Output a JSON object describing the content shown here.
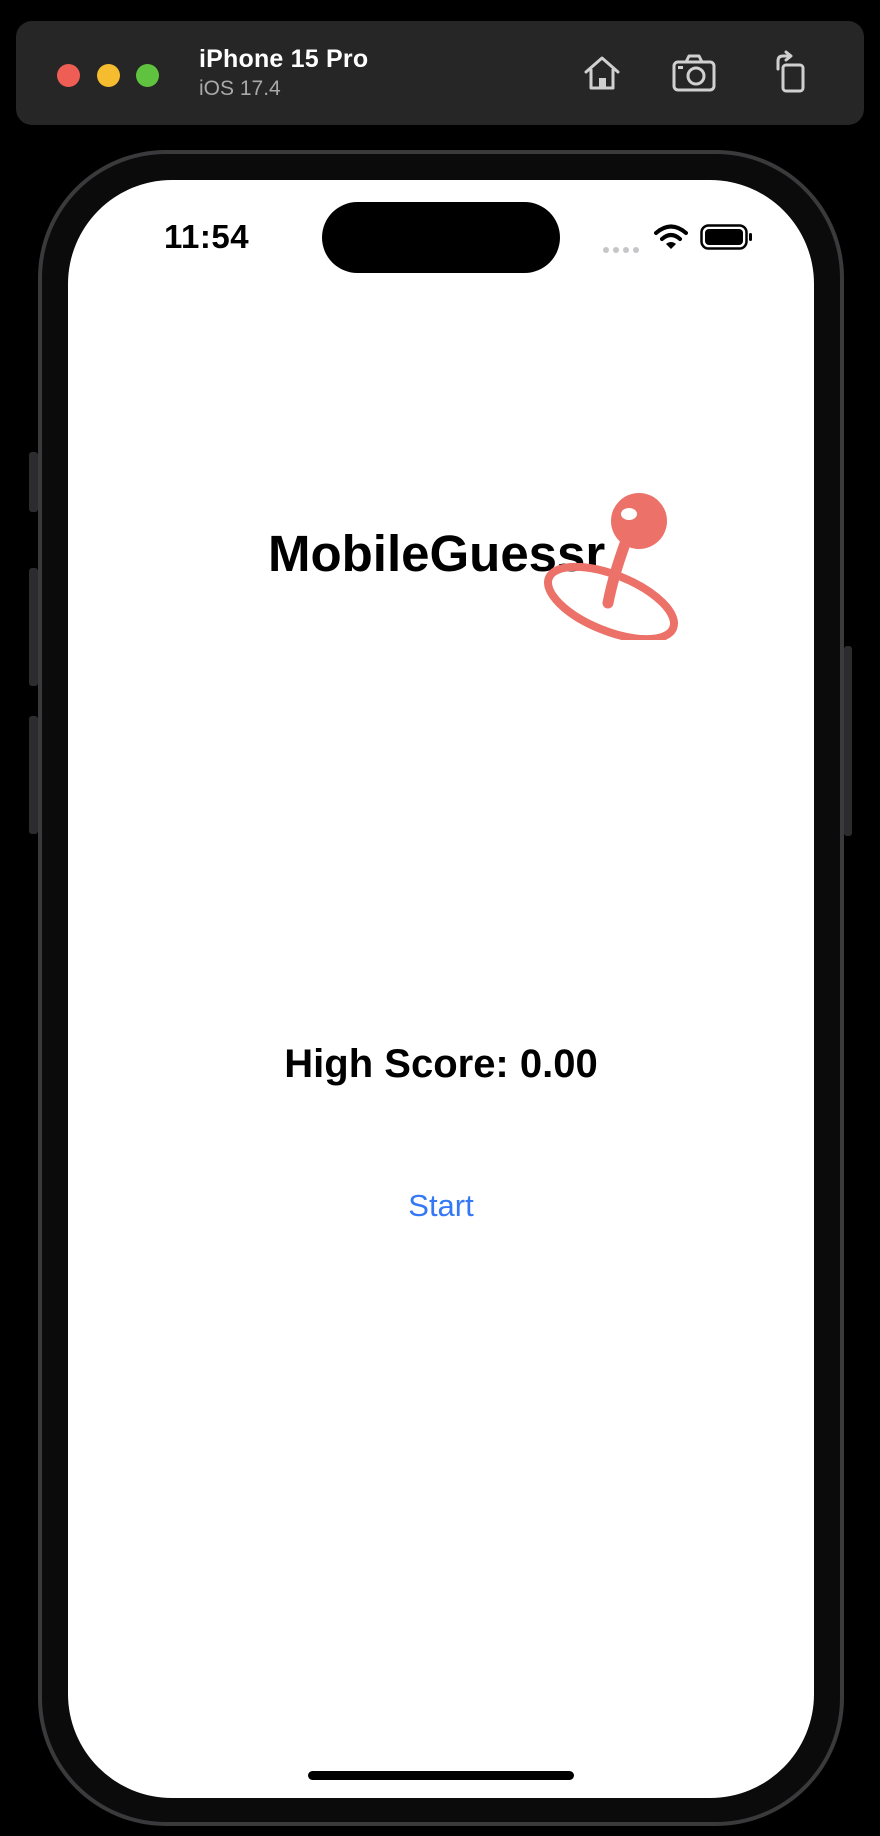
{
  "simulator": {
    "device_name": "iPhone 15 Pro",
    "os_version": "iOS 17.4",
    "toolbar_icons": [
      "home-icon",
      "screenshot-icon",
      "rotate-icon"
    ]
  },
  "status_bar": {
    "time": "11:54",
    "icons": [
      "cellular-dots-icon",
      "wifi-icon",
      "battery-icon"
    ]
  },
  "app": {
    "title": "MobileGuessr",
    "logo_icon": "map-pin-icon",
    "high_score_text": "High Score: 0.00",
    "start_label": "Start"
  },
  "colors": {
    "accent": "#3478f6",
    "logo": "#ec7168",
    "close": "#ee5e55",
    "minimize": "#f5bc2f",
    "zoom": "#5fc33f"
  }
}
